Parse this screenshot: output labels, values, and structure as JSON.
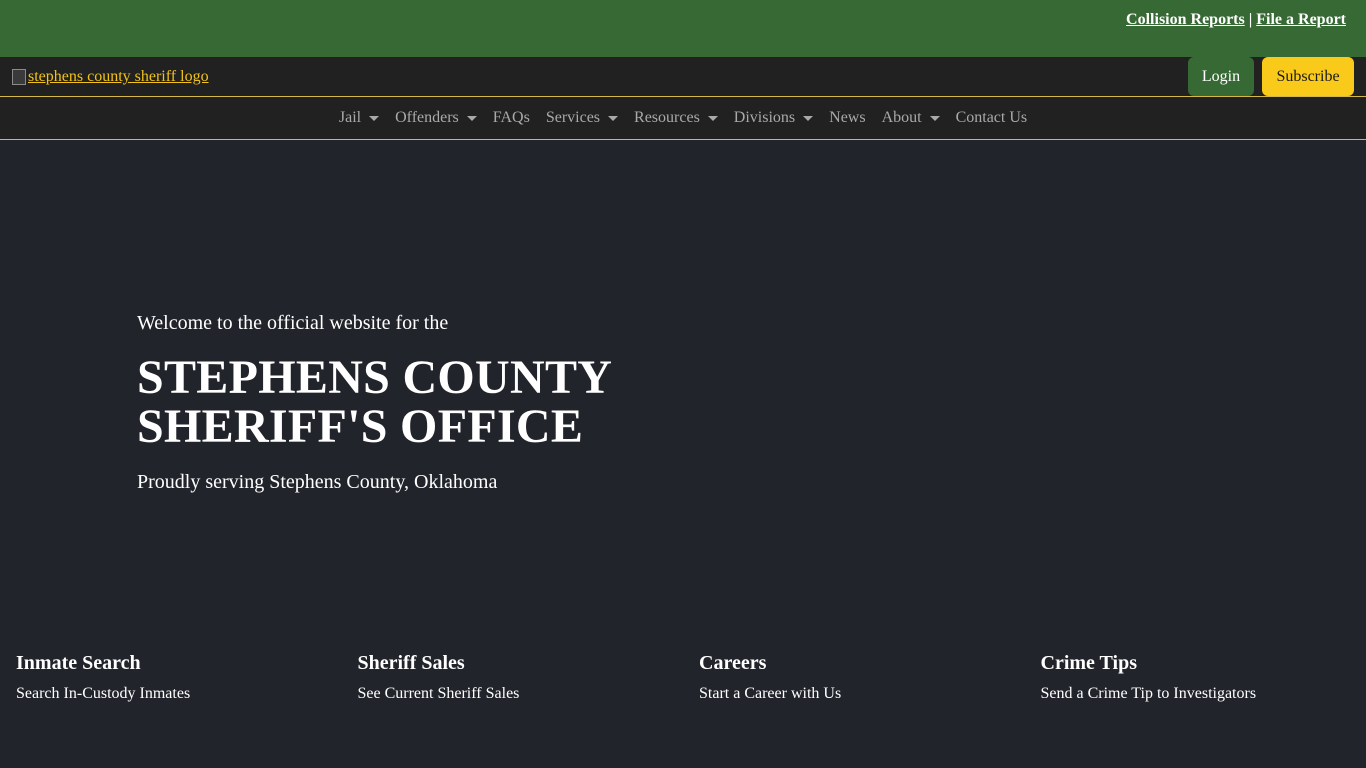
{
  "topbar": {
    "links": [
      "Collision Reports",
      "File a Report"
    ],
    "separator": "|"
  },
  "brand": {
    "logo_alt": "stephens county sheriff logo",
    "login_label": "Login",
    "subscribe_label": "Subscribe"
  },
  "nav": {
    "items": [
      {
        "label": "Jail",
        "dropdown": true
      },
      {
        "label": "Offenders",
        "dropdown": true
      },
      {
        "label": "FAQs",
        "dropdown": false
      },
      {
        "label": "Services",
        "dropdown": true
      },
      {
        "label": "Resources",
        "dropdown": true
      },
      {
        "label": "Divisions",
        "dropdown": true
      },
      {
        "label": "News",
        "dropdown": false
      },
      {
        "label": "About",
        "dropdown": true
      },
      {
        "label": "Contact Us",
        "dropdown": false
      }
    ]
  },
  "hero": {
    "welcome": "Welcome to the official website for the",
    "title_line1": "STEPHENS COUNTY",
    "title_line2": "SHERIFF'S OFFICE",
    "tagline": "Proudly serving Stephens County, Oklahoma"
  },
  "features": [
    {
      "title": "Inmate Search",
      "desc": "Search In-Custody Inmates"
    },
    {
      "title": "Sheriff Sales",
      "desc": "See Current Sheriff Sales"
    },
    {
      "title": "Careers",
      "desc": "Start a Career with Us"
    },
    {
      "title": "Crime Tips",
      "desc": "Send a Crime Tip to Investigators"
    }
  ],
  "colors": {
    "topbar_green": "#376934",
    "dark_bar": "#212121",
    "page_bg": "#21242b",
    "accent_yellow": "#f9ca1a",
    "nav_text": "#a9a9a9"
  }
}
